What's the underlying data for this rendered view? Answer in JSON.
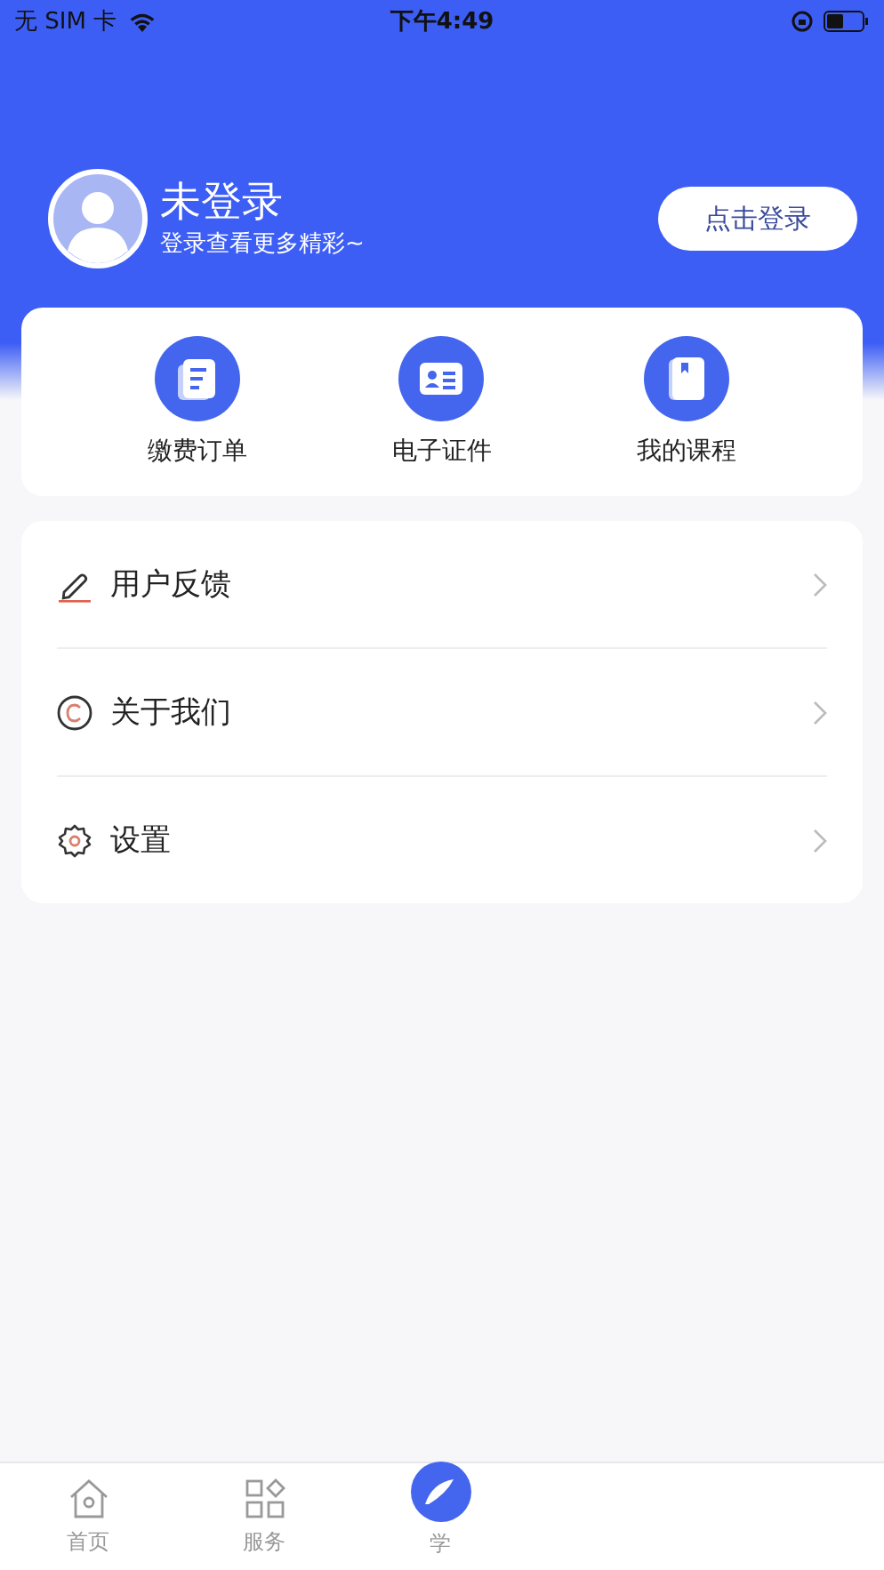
{
  "status_bar": {
    "carrier": "无 SIM 卡",
    "time": "下午4:49"
  },
  "profile": {
    "name": "未登录",
    "subtitle": "登录查看更多精彩~",
    "login_button": "点击登录"
  },
  "shortcuts": [
    {
      "label": "缴费订单",
      "kind": "document"
    },
    {
      "label": "电子证件",
      "kind": "id-card"
    },
    {
      "label": "我的课程",
      "kind": "book"
    }
  ],
  "menu": [
    {
      "label": "用户反馈",
      "kind": "pencil"
    },
    {
      "label": "关于我们",
      "kind": "copyright"
    },
    {
      "label": "设置",
      "kind": "gear"
    }
  ],
  "tab_bar": [
    {
      "label": "首页",
      "kind": "home",
      "selected": false
    },
    {
      "label": "服务",
      "kind": "grid",
      "selected": false
    },
    {
      "label": "学",
      "kind": "center",
      "selected": false
    }
  ]
}
